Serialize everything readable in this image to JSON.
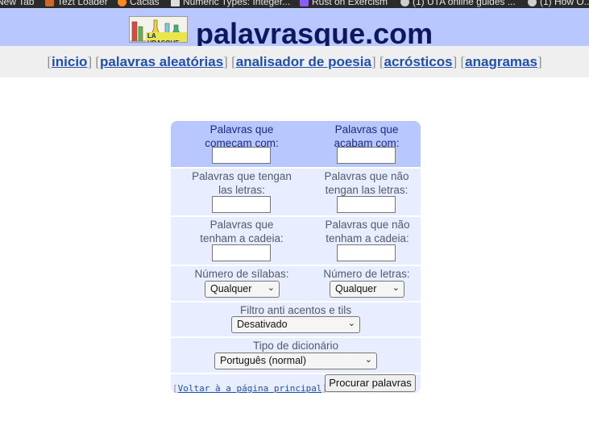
{
  "bookmarks": [
    {
      "label": "New Tab",
      "icon": "page-icon"
    },
    {
      "label": "Tezt Loader",
      "icon": "bookmark-icon"
    },
    {
      "label": "Cacias",
      "icon": "orange-circle-icon"
    },
    {
      "label": "Numeric Types: Integer...",
      "icon": "document-icon"
    },
    {
      "label": "Rust on Exercism",
      "icon": "purple-bracket-icon"
    },
    {
      "label": "(1) UTA online guides ...",
      "icon": "globe-icon"
    },
    {
      "label": "(1) How O...",
      "icon": "globe-icon"
    }
  ],
  "header": {
    "site_title": "palavrasque.com",
    "logo_text": "LA VRASQUE"
  },
  "nav": {
    "links": [
      "inicio",
      "palavras aleatórias",
      "analisador de poesia",
      "acrósticos",
      "anagramas"
    ]
  },
  "form": {
    "starts_with_label": "Palavras que começam com:",
    "starts_with_value": "",
    "ends_with_label": "Palavras que acabam com:",
    "ends_with_value": "",
    "contain_letters_label": "Palavras que tengan las letras:",
    "contain_letters_value": "",
    "not_contain_letters_label": "Palavras que não tengan las letras:",
    "not_contain_letters_value": "",
    "contain_string_label": "Palavras que tenham a cadeia:",
    "contain_string_value": "",
    "not_contain_string_label": "Palavras que não tenham a cadeia:",
    "not_contain_string_value": "",
    "syllables_label": "Número de sílabas:",
    "syllables_value": "Qualquer",
    "letters_label": "Número de letras:",
    "letters_value": "Qualquer",
    "accent_filter_label": "Filtro anti acentos e tils",
    "accent_filter_value": "Desativado",
    "dictionary_label": "Tipo de dicionário",
    "dictionary_value": "Português (normal)",
    "back_link": "Voltar à a página principal",
    "submit": "Procurar palavras"
  },
  "colors": {
    "header_bg": "#b9c7ff",
    "title": "#0f1660",
    "nav_bg": "#efefef",
    "link": "#1f4fb0",
    "form_header_bg": "#b9c7ff",
    "form_row_bg": "#e8eeff"
  }
}
